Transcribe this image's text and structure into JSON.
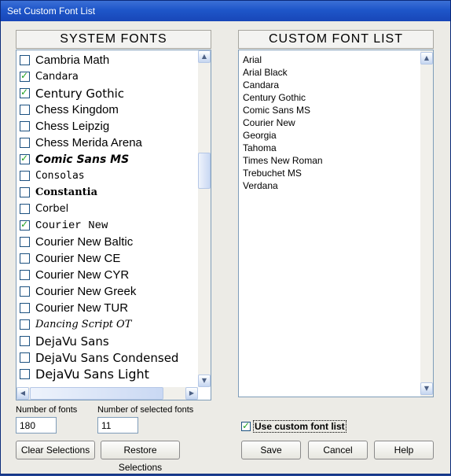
{
  "window": {
    "title": "Set Custom Font List"
  },
  "system_fonts": {
    "header": "SYSTEM FONTS",
    "items": [
      {
        "label": "Cambria Math",
        "checked": false,
        "family": "\"Liberation Sans\", sans-serif",
        "size": "15px",
        "style": "normal",
        "weight": "normal"
      },
      {
        "label": "Candara",
        "checked": true,
        "family": "\"DejaVu Sans\", sans-serif",
        "size": "13px",
        "style": "normal",
        "weight": "normal"
      },
      {
        "label": "Century Gothic",
        "checked": true,
        "family": "\"DejaVu Sans\", sans-serif",
        "size": "15px",
        "style": "normal",
        "weight": "normal"
      },
      {
        "label": "Chess Kingdom",
        "checked": false,
        "family": "\"Liberation Sans\", sans-serif",
        "size": "15px",
        "style": "normal",
        "weight": "normal"
      },
      {
        "label": "Chess Leipzig",
        "checked": false,
        "family": "\"Liberation Sans\", sans-serif",
        "size": "15px",
        "style": "normal",
        "weight": "normal"
      },
      {
        "label": "Chess Merida Arena",
        "checked": false,
        "family": "\"Liberation Sans\", sans-serif",
        "size": "15px",
        "style": "normal",
        "weight": "normal"
      },
      {
        "label": "Comic Sans MS",
        "checked": true,
        "family": "\"DejaVu Sans\", sans-serif",
        "size": "14px",
        "style": "italic",
        "weight": "bold"
      },
      {
        "label": "Consolas",
        "checked": false,
        "family": "\"DejaVu Sans Mono\", monospace",
        "size": "13px",
        "style": "normal",
        "weight": "normal"
      },
      {
        "label": "Constantia",
        "checked": false,
        "family": "\"DejaVu Serif\", serif",
        "size": "13px",
        "style": "normal",
        "weight": "bold"
      },
      {
        "label": "Corbel",
        "checked": false,
        "family": "\"DejaVu Sans\", sans-serif",
        "size": "13px",
        "style": "normal",
        "weight": "normal"
      },
      {
        "label": "Courier New",
        "checked": true,
        "family": "\"Liberation Mono\", monospace",
        "size": "14px",
        "style": "normal",
        "weight": "normal"
      },
      {
        "label": "Courier New Baltic",
        "checked": false,
        "family": "\"Liberation Sans\", sans-serif",
        "size": "15px",
        "style": "normal",
        "weight": "normal"
      },
      {
        "label": "Courier New CE",
        "checked": false,
        "family": "\"Liberation Sans\", sans-serif",
        "size": "15px",
        "style": "normal",
        "weight": "normal"
      },
      {
        "label": "Courier New CYR",
        "checked": false,
        "family": "\"Liberation Sans\", sans-serif",
        "size": "15px",
        "style": "normal",
        "weight": "normal"
      },
      {
        "label": "Courier New Greek",
        "checked": false,
        "family": "\"Liberation Sans\", sans-serif",
        "size": "15px",
        "style": "normal",
        "weight": "normal"
      },
      {
        "label": "Courier New TUR",
        "checked": false,
        "family": "\"Liberation Sans\", sans-serif",
        "size": "15px",
        "style": "normal",
        "weight": "normal"
      },
      {
        "label": "Dancing Script OT",
        "checked": false,
        "family": "\"DejaVu Serif\", serif",
        "size": "13px",
        "style": "italic",
        "weight": "normal"
      },
      {
        "label": "DejaVu Sans",
        "checked": false,
        "family": "\"DejaVu Sans\", sans-serif",
        "size": "15px",
        "style": "normal",
        "weight": "normal"
      },
      {
        "label": "DejaVu Sans Condensed",
        "checked": false,
        "family": "\"DejaVu Sans\", sans-serif",
        "size": "15px",
        "style": "normal",
        "weight": "normal"
      },
      {
        "label": "DejaVu Sans Light",
        "checked": false,
        "family": "\"DejaVu Sans\", sans-serif",
        "size": "16px",
        "style": "normal",
        "weight": "normal"
      }
    ]
  },
  "custom_fonts": {
    "header": "CUSTOM FONT LIST",
    "items": [
      "Arial",
      "Arial Black",
      "Candara",
      "Century Gothic",
      "Comic Sans MS",
      "Courier New",
      "Georgia",
      "Tahoma",
      "Times New Roman",
      "Trebuchet MS",
      "Verdana"
    ]
  },
  "counts": {
    "fonts_label": "Number of fonts",
    "fonts_value": "180",
    "selected_label": "Number of selected fonts",
    "selected_value": "11"
  },
  "use_custom": {
    "label": "Use custom font list",
    "checked": true
  },
  "buttons": {
    "clear": "Clear Selections",
    "restore": "Restore Selections",
    "save": "Save",
    "cancel": "Cancel",
    "help": "Help"
  },
  "icons": {
    "check": "✓",
    "arrow_up": "▲",
    "arrow_down": "▼",
    "arrow_left": "◀",
    "arrow_right": "▶"
  }
}
